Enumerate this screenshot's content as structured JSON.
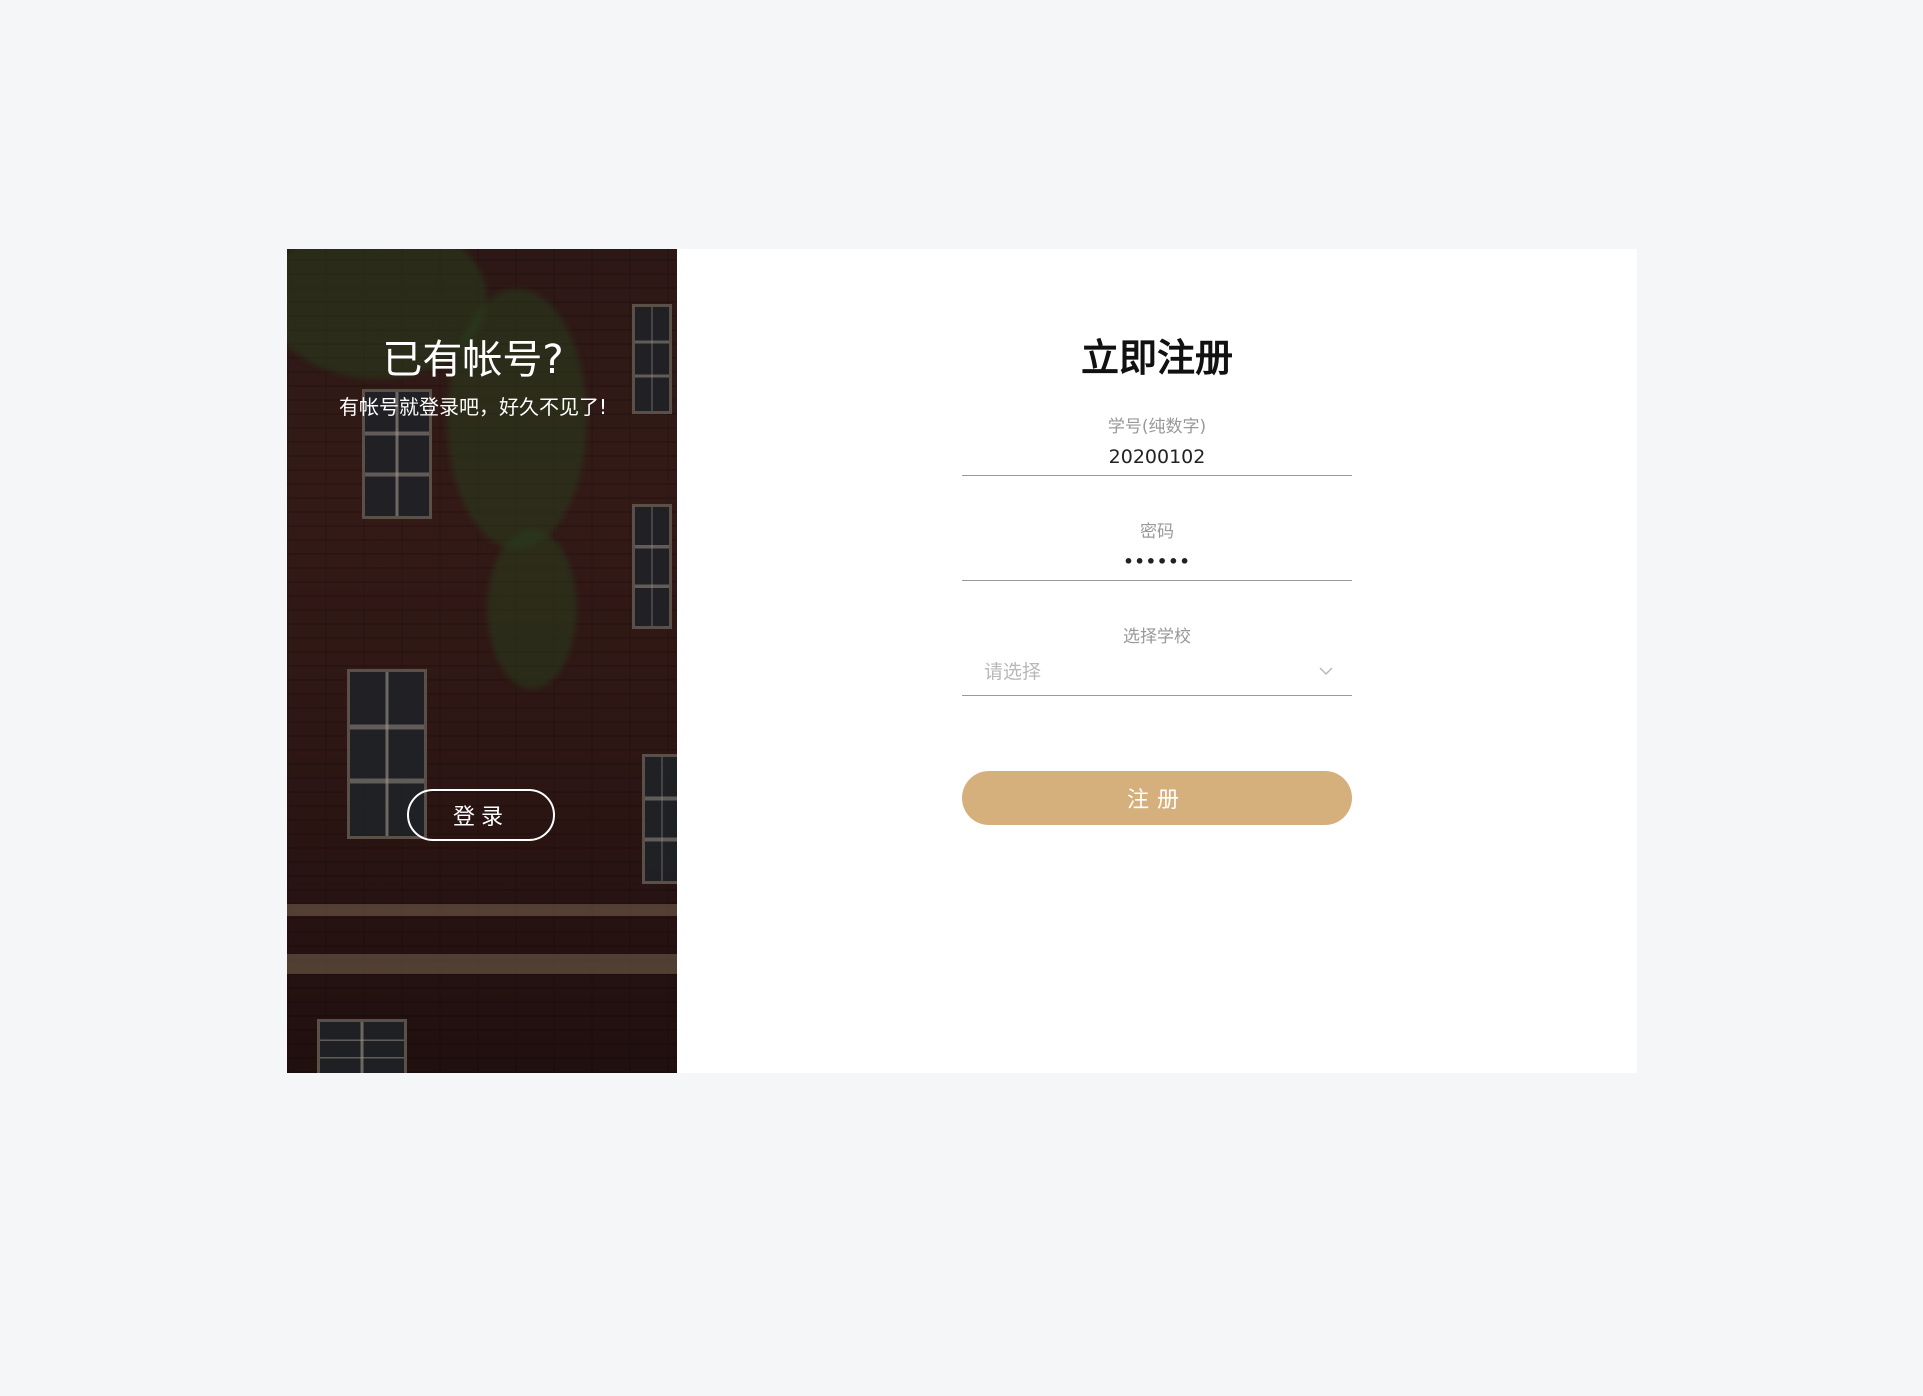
{
  "left_panel": {
    "title": "已有帐号?",
    "subtitle": "有帐号就登录吧，好久不见了!",
    "login_button": "登录"
  },
  "form": {
    "title": "立即注册",
    "student_id": {
      "label": "学号(纯数字)",
      "value": "20200102"
    },
    "password": {
      "label": "密码",
      "value": "••••••"
    },
    "school": {
      "label": "选择学校",
      "placeholder": "请选择"
    },
    "submit_button": "注册"
  },
  "colors": {
    "page_background": "#f5f6f8",
    "accent": "#d5b07d",
    "card_background": "#ffffff"
  },
  "icons": {
    "select_dropdown": "chevron-down-icon"
  }
}
